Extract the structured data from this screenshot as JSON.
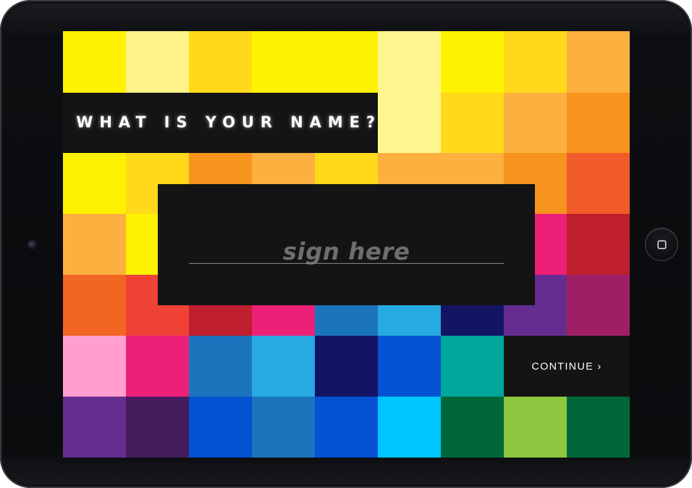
{
  "prompt": {
    "title": "WHAT IS YOUR NAME?"
  },
  "signature": {
    "placeholder": "sign here"
  },
  "actions": {
    "continue_label": "CONTINUE ›"
  },
  "colors": {
    "panel": "#141414",
    "tiles": [
      [
        "#fff200",
        "#fff38a",
        "#ffd91a",
        "#fff200",
        "#fff200",
        "#fff68f",
        "#fff200",
        "#ffd91a",
        "#fbb040"
      ],
      [
        "#141414",
        "#141414",
        "#141414",
        "#141414",
        "#141414",
        "#fff68f",
        "#ffd91a",
        "#fbb040",
        "#f7941d"
      ],
      [
        "#fff200",
        "#ffd91a",
        "#f7941d",
        "#fbb040",
        "#ffd91a",
        "#fbb040",
        "#fbb040",
        "#f7941d",
        "#f15a29"
      ],
      [
        "#fbb040",
        "#fff200",
        "#f7941d",
        "#f15a29",
        "#ee4036",
        "#be1e2d",
        "#be1e2d",
        "#ed2078",
        "#be1e2d"
      ],
      [
        "#f26522",
        "#ef4136",
        "#be1e2d",
        "#ed2078",
        "#1c75bc",
        "#27aae1",
        "#141464",
        "#662d91",
        "#9e1f63"
      ],
      [
        "#ff9ecf",
        "#ed2078",
        "#1c75bc",
        "#27aae1",
        "#141464",
        "#0552d3",
        "#00a79d",
        "#141414",
        "#141414"
      ],
      [
        "#662d91",
        "#441c5e",
        "#0552d3",
        "#1c75bc",
        "#0552d3",
        "#00c6ff",
        "#006838",
        "#8dc63f",
        "#006838"
      ]
    ]
  }
}
